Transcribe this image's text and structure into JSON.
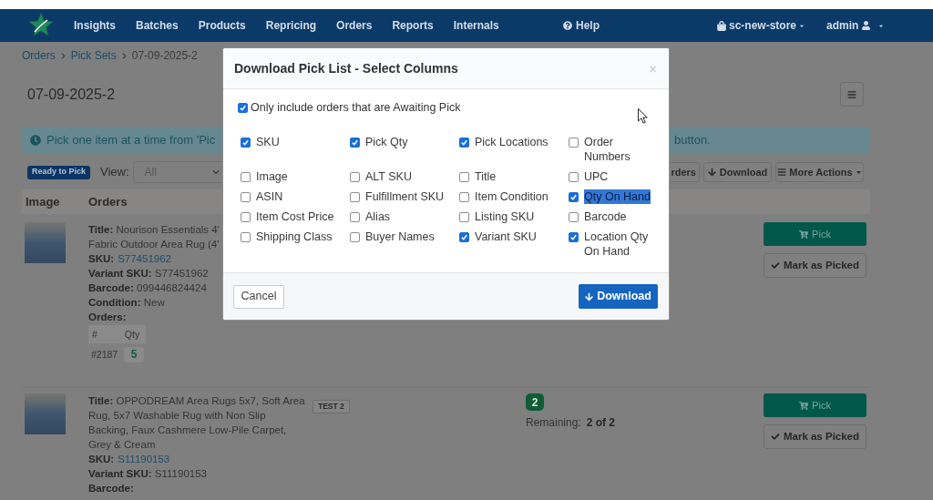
{
  "navbar": {
    "links": [
      {
        "label": "Insights"
      },
      {
        "label": "Batches"
      },
      {
        "label": "Products"
      },
      {
        "label": "Repricing"
      },
      {
        "label": "Orders"
      },
      {
        "label": "Reports"
      },
      {
        "label": "Internals"
      }
    ],
    "help": "Help",
    "store": "sc-new-store",
    "user": "admin"
  },
  "breadcrumb": [
    {
      "label": "Orders",
      "kind": "link"
    },
    {
      "label": "Pick Sets",
      "kind": "link"
    },
    {
      "label": "07-09-2025-2",
      "kind": "current"
    }
  ],
  "page_title": "07-09-2025-2",
  "alert": {
    "text": "Pick one item at a time from 'Pic",
    "text_after_dialog": "button."
  },
  "toolbar": {
    "status": "Ready to Pick",
    "view_label": "View:",
    "view_value": "All",
    "buttons": [
      {
        "label": "rders",
        "kind": "clipped"
      },
      {
        "label": "Download",
        "kind": "download"
      },
      {
        "label": "More Actions",
        "kind": "menu"
      }
    ]
  },
  "table": {
    "columns": [
      "Image",
      "Orders"
    ],
    "rows": [
      {
        "title": {
          "label": "Title:",
          "lines": [
            "Nourison Essentials 4'",
            "Fabric Outdoor Area Rug (4'"
          ]
        },
        "sku": {
          "label": "SKU:",
          "value": "S77451962"
        },
        "details": [
          {
            "label": "Variant SKU:",
            "value": "S77451962"
          },
          {
            "label": "Barcode:",
            "value": "099446824424"
          },
          {
            "label": "Condition:",
            "value": "New"
          }
        ],
        "orders": {
          "label": "Orders:",
          "columns": [
            "#",
            "Qty"
          ],
          "rows": [
            {
              "number": "#2187",
              "qty": "5"
            }
          ]
        },
        "actions": [
          {
            "label": "Pick",
            "kind": "pick"
          },
          {
            "label": "Mark as Picked",
            "kind": "mark"
          }
        ]
      },
      {
        "title": {
          "label": "Title:",
          "lines": [
            "OPPODREAM Area Rugs 5x7, Soft Area",
            "Rug, 5x7 Washable Rug with Non Slip",
            "Backing, Faux Cashmere Low-Pile Carpet,",
            "Grey & Cream"
          ]
        },
        "tag": "TEST 2",
        "sku": {
          "label": "SKU:",
          "value": "S11190153"
        },
        "details": [
          {
            "label": "Variant SKU:",
            "value": "S11190153"
          },
          {
            "label": "Barcode:"
          }
        ],
        "status": {
          "count": "2",
          "label": "Remaining:",
          "value": "2 of 2"
        },
        "actions": [
          {
            "label": "Pick",
            "kind": "pick"
          },
          {
            "label": "Mark as Picked",
            "kind": "mark"
          }
        ]
      }
    ]
  },
  "dialog": {
    "title": "Download Pick List - Select Columns",
    "close": "×",
    "awaiting_only": {
      "label": "Only include orders that are Awaiting Pick",
      "checked": true
    },
    "columns": [
      {
        "label": "SKU",
        "checked": true,
        "highlighted": false
      },
      {
        "label": "Pick Qty",
        "checked": true,
        "highlighted": false
      },
      {
        "label": "Pick Locations",
        "checked": true,
        "highlighted": false
      },
      {
        "label": "Order Numbers",
        "checked": false,
        "highlighted": false
      },
      {
        "label": "Image",
        "checked": false,
        "highlighted": false
      },
      {
        "label": "ALT SKU",
        "checked": false,
        "highlighted": false
      },
      {
        "label": "Title",
        "checked": false,
        "highlighted": false
      },
      {
        "label": "UPC",
        "checked": false,
        "highlighted": false
      },
      {
        "label": "ASIN",
        "checked": false,
        "highlighted": false
      },
      {
        "label": "Fulfillment SKU",
        "checked": false,
        "highlighted": false
      },
      {
        "label": "Item Condition",
        "checked": false,
        "highlighted": false
      },
      {
        "label": "Qty On Hand",
        "checked": true,
        "highlighted": true
      },
      {
        "label": "Item Cost Price",
        "checked": false,
        "highlighted": false
      },
      {
        "label": "Alias",
        "checked": false,
        "highlighted": false
      },
      {
        "label": "Listing SKU",
        "checked": false,
        "highlighted": false
      },
      {
        "label": "Barcode",
        "checked": false,
        "highlighted": false
      },
      {
        "label": "Shipping Class",
        "checked": false,
        "highlighted": false
      },
      {
        "label": "Buyer Names",
        "checked": false,
        "highlighted": false
      },
      {
        "label": "Variant SKU",
        "checked": true,
        "highlighted": false
      },
      {
        "label": "Location Qty On Hand",
        "checked": true,
        "highlighted": false
      }
    ],
    "buttons": [
      {
        "label": "Cancel",
        "kind": "secondary"
      },
      {
        "label": "Download",
        "kind": "primary"
      }
    ]
  }
}
